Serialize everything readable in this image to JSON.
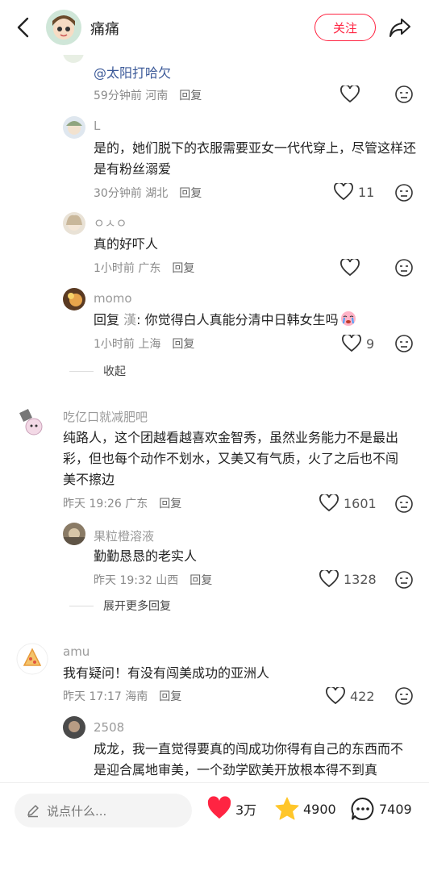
{
  "header": {
    "author": "痛痛",
    "follow": "关注"
  },
  "comments": [
    {
      "text": "@太阳打哈欠",
      "time": "59分钟前",
      "region": "河南",
      "reply": "回复"
    },
    {
      "user": "L",
      "text": "是的，她们脱下的衣服需要亚女一代代穿上，尽管这样还是有粉丝溺爱",
      "time": "30分钟前",
      "region": "湖北",
      "reply": "回复",
      "likes": "11"
    },
    {
      "user": "ㅇㅅㅇ",
      "text": "真的好吓人",
      "time": "1小时前",
      "region": "广东",
      "reply": "回复"
    },
    {
      "user": "momo",
      "reply_prefix": "回复",
      "reply_to": "漢",
      "text": ": 你觉得白人真能分清中日韩女生吗",
      "time": "1小时前",
      "region": "上海",
      "reply": "回复",
      "likes": "9"
    },
    {
      "fold": "收起"
    },
    {
      "user": "吃亿口就减肥吧",
      "text": "纯路人，这个团越看越喜欢金智秀，虽然业务能力不是最出彩，但也每个动作不划水，又美又有气质，火了之后也不闯美不擦边",
      "time": "昨天 19:26",
      "region": "广东",
      "reply": "回复",
      "likes": "1601"
    },
    {
      "user": "果粒橙溶液",
      "text": "勤勤恳恳的老实人",
      "time": "昨天 19:32",
      "region": "山西",
      "reply": "回复",
      "likes": "1328"
    },
    {
      "expand": "展开更多回复"
    },
    {
      "user": "amu",
      "text": "我有疑问！有没有闯美成功的亚洲人",
      "time": "昨天 17:17",
      "region": "海南",
      "reply": "回复",
      "likes": "422"
    },
    {
      "user": "2508",
      "text": "成龙，我一直觉得要真的闯成功你得有自己的东西而不是迎合属地审美，一个劲学欧美开放根本得不到真"
    }
  ],
  "bottom": {
    "placeholder": "说点什么...",
    "likes": "3万",
    "stars": "4900",
    "comments": "7409"
  },
  "colors": {
    "accent": "#ff2442",
    "star": "#ffc629"
  }
}
